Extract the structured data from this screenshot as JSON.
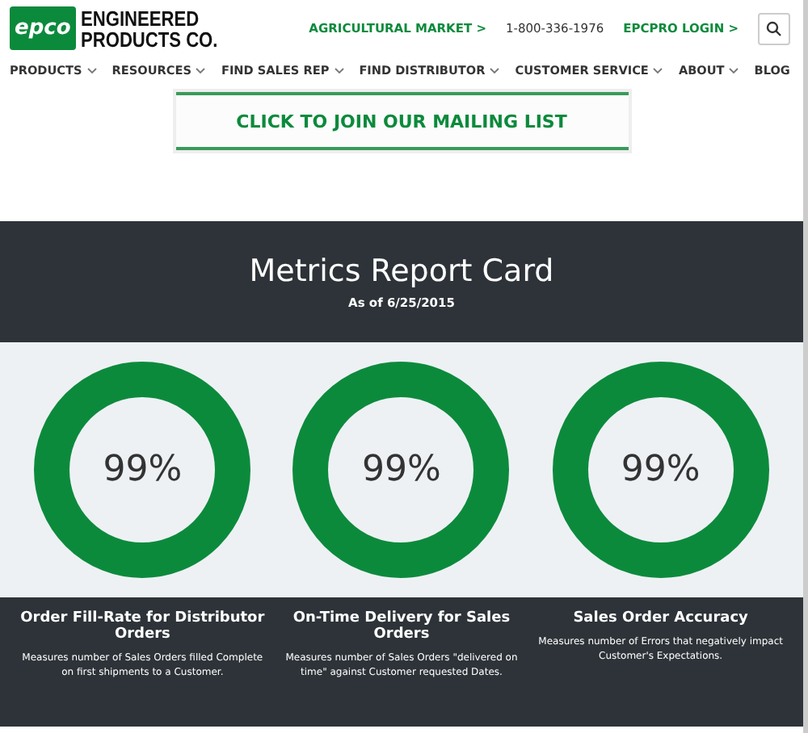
{
  "logo": {
    "mark": "epco",
    "name_line1": "ENGINEERED",
    "name_line2": "PRODUCTS CO."
  },
  "top_links": [
    {
      "label": "AGRICULTURAL MARKET >",
      "kind": "link"
    },
    {
      "label": "1-800-336-1976",
      "kind": "phone"
    },
    {
      "label": "EPCPRO LOGIN >",
      "kind": "link"
    }
  ],
  "nav": [
    {
      "label": "PRODUCTS",
      "dropdown": true
    },
    {
      "label": "RESOURCES",
      "dropdown": true
    },
    {
      "label": "FIND SALES REP",
      "dropdown": true
    },
    {
      "label": "FIND DISTRIBUTOR",
      "dropdown": true
    },
    {
      "label": "CUSTOMER SERVICE",
      "dropdown": true
    },
    {
      "label": "ABOUT",
      "dropdown": true
    },
    {
      "label": "BLOG",
      "dropdown": false
    }
  ],
  "mailing_button": "CLICK TO JOIN OUR MAILING LIST",
  "report": {
    "title": "Metrics Report Card",
    "date": "As of 6/25/2015"
  },
  "metrics": [
    {
      "value": "99%",
      "title": "Order Fill-Rate for Distributor Orders",
      "description": "Measures number of Sales Orders filled Complete on first shipments to a Customer."
    },
    {
      "value": "99%",
      "title": "On-Time Delivery for Sales Orders",
      "description": "Measures number of Sales Orders \"delivered on time\" against Customer requested Dates."
    },
    {
      "value": "99%",
      "title": "Sales Order Accuracy",
      "description": "Measures number of Errors that negatively impact Customer's Expectations."
    }
  ]
}
